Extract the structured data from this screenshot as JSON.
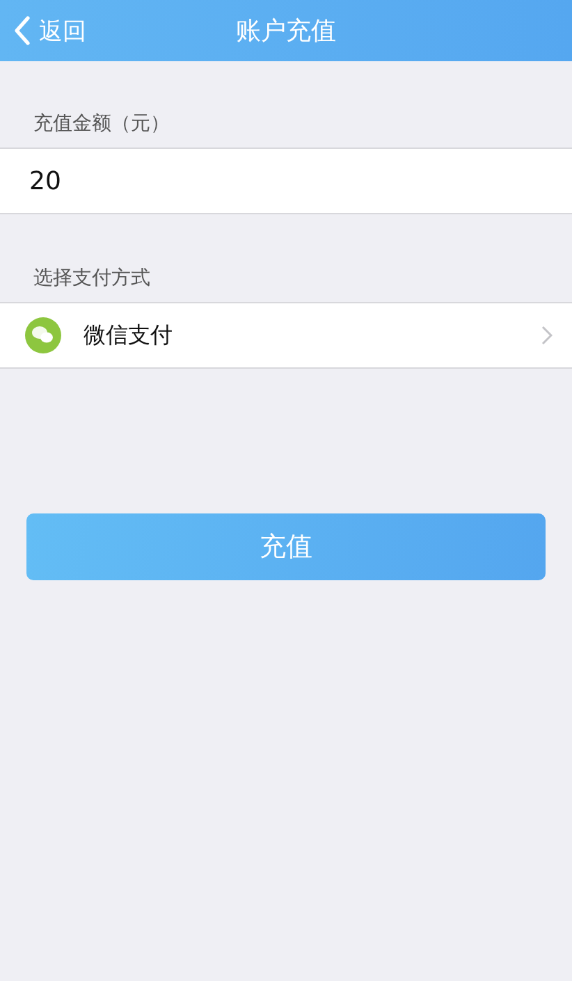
{
  "nav_bar": {
    "back": "返回",
    "title": "账户充值"
  },
  "amount": {
    "label": "充值金额（元）",
    "value": "20"
  },
  "payment": {
    "label": "选择支付方式",
    "method": "微信支付"
  },
  "submit_button": "充值"
}
